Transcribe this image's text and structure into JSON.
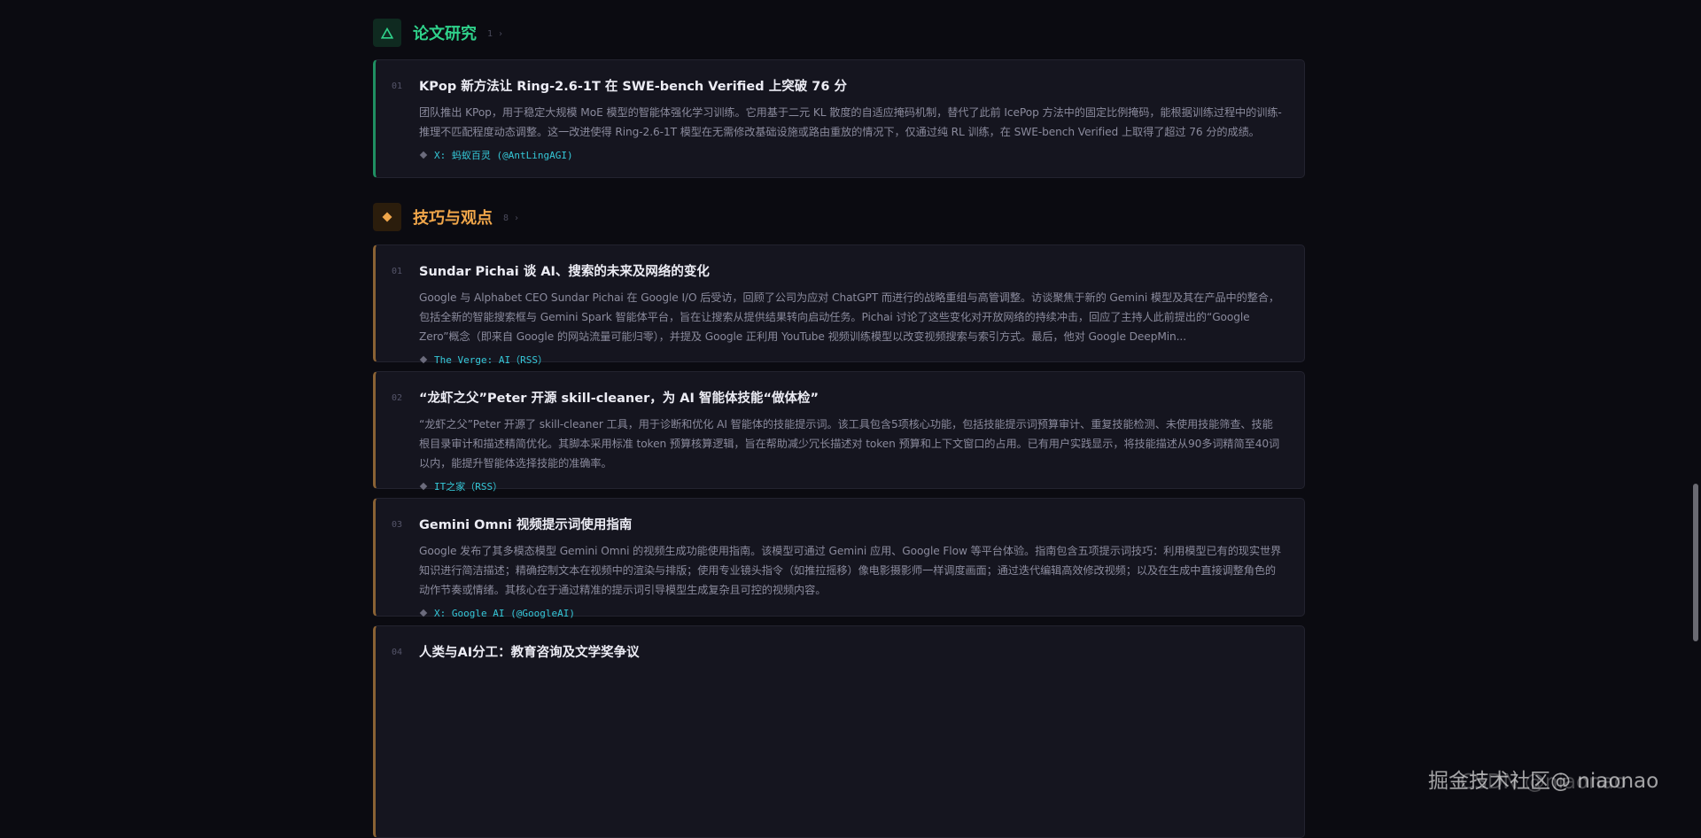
{
  "sections": [
    {
      "title": "论文研究",
      "count": "1 ›",
      "icon": "triangle-icon",
      "accent": "#2fd28b",
      "cards": [
        {
          "num": "01",
          "title": "KPop 新方法让 Ring-2.6-1T 在 SWE-bench Verified 上突破 76 分",
          "desc": "团队推出 KPop，用于稳定大规模 MoE 模型的智能体强化学习训练。它用基于二元 KL 散度的自适应掩码机制，替代了此前 IcePop 方法中的固定比例掩码，能根据训练过程中的训练-推理不匹配程度动态调整。这一改进使得 Ring-2.6-1T 模型在无需修改基础设施或路由重放的情况下，仅通过纯 RL 训练，在 SWE-bench Verified 上取得了超过 76 分的成绩。",
          "source": "X: 蚂蚁百灵 (@AntLingAGI)"
        }
      ]
    },
    {
      "title": "技巧与观点",
      "count": "8 ›",
      "icon": "diamond-icon",
      "accent": "#f0a64a",
      "cards": [
        {
          "num": "01",
          "title": "Sundar Pichai 谈 AI、搜索的未来及网络的变化",
          "desc": "Google 与 Alphabet CEO Sundar Pichai 在 Google I/O 后受访，回顾了公司为应对 ChatGPT 而进行的战略重组与高管调整。访谈聚焦于新的 Gemini 模型及其在产品中的整合，包括全新的智能搜索框与 Gemini Spark 智能体平台，旨在让搜索从提供结果转向启动任务。Pichai 讨论了这些变化对开放网络的持续冲击，回应了主持人此前提出的“Google Zero”概念（即来自 Google 的网站流量可能归零），并提及 Google 正利用 YouTube 视频训练模型以改变视频搜索与索引方式。最后，他对 Google DeepMin...",
          "source": "The Verge: AI（RSS）"
        },
        {
          "num": "02",
          "title": "“龙虾之父”Peter 开源 skill-cleaner，为 AI 智能体技能“做体检”",
          "desc": "“龙虾之父”Peter 开源了 skill-cleaner 工具，用于诊断和优化 AI 智能体的技能提示词。该工具包含5项核心功能，包括技能提示词预算审计、重复技能检测、未使用技能筛查、技能根目录审计和描述精简优化。其脚本采用标准 token 预算核算逻辑，旨在帮助减少冗长描述对 token 预算和上下文窗口的占用。已有用户实践显示，将技能描述从90多词精简至40词以内，能提升智能体选择技能的准确率。",
          "source": "IT之家（RSS）"
        },
        {
          "num": "03",
          "title": "Gemini Omni 视频提示词使用指南",
          "desc": "Google 发布了其多模态模型 Gemini Omni 的视频生成功能使用指南。该模型可通过 Gemini 应用、Google Flow 等平台体验。指南包含五项提示词技巧：利用模型已有的现实世界知识进行简洁描述；精确控制文本在视频中的渲染与排版；使用专业镜头指令（如推拉摇移）像电影摄影师一样调度画面；通过迭代编辑高效修改视频；以及在生成中直接调整角色的动作节奏或情绪。其核心在于通过精准的提示词引导模型生成复杂且可控的视频内容。",
          "source": "X: Google AI (@GoogleAI)"
        },
        {
          "num": "04",
          "title": "人类与AI分工：教育咨询及文学奖争议",
          "desc": "",
          "source": ""
        }
      ]
    }
  ],
  "watermark": {
    "text": "掘金技术社区@ niaonao",
    "ghost": "CSDN @niaonao"
  }
}
